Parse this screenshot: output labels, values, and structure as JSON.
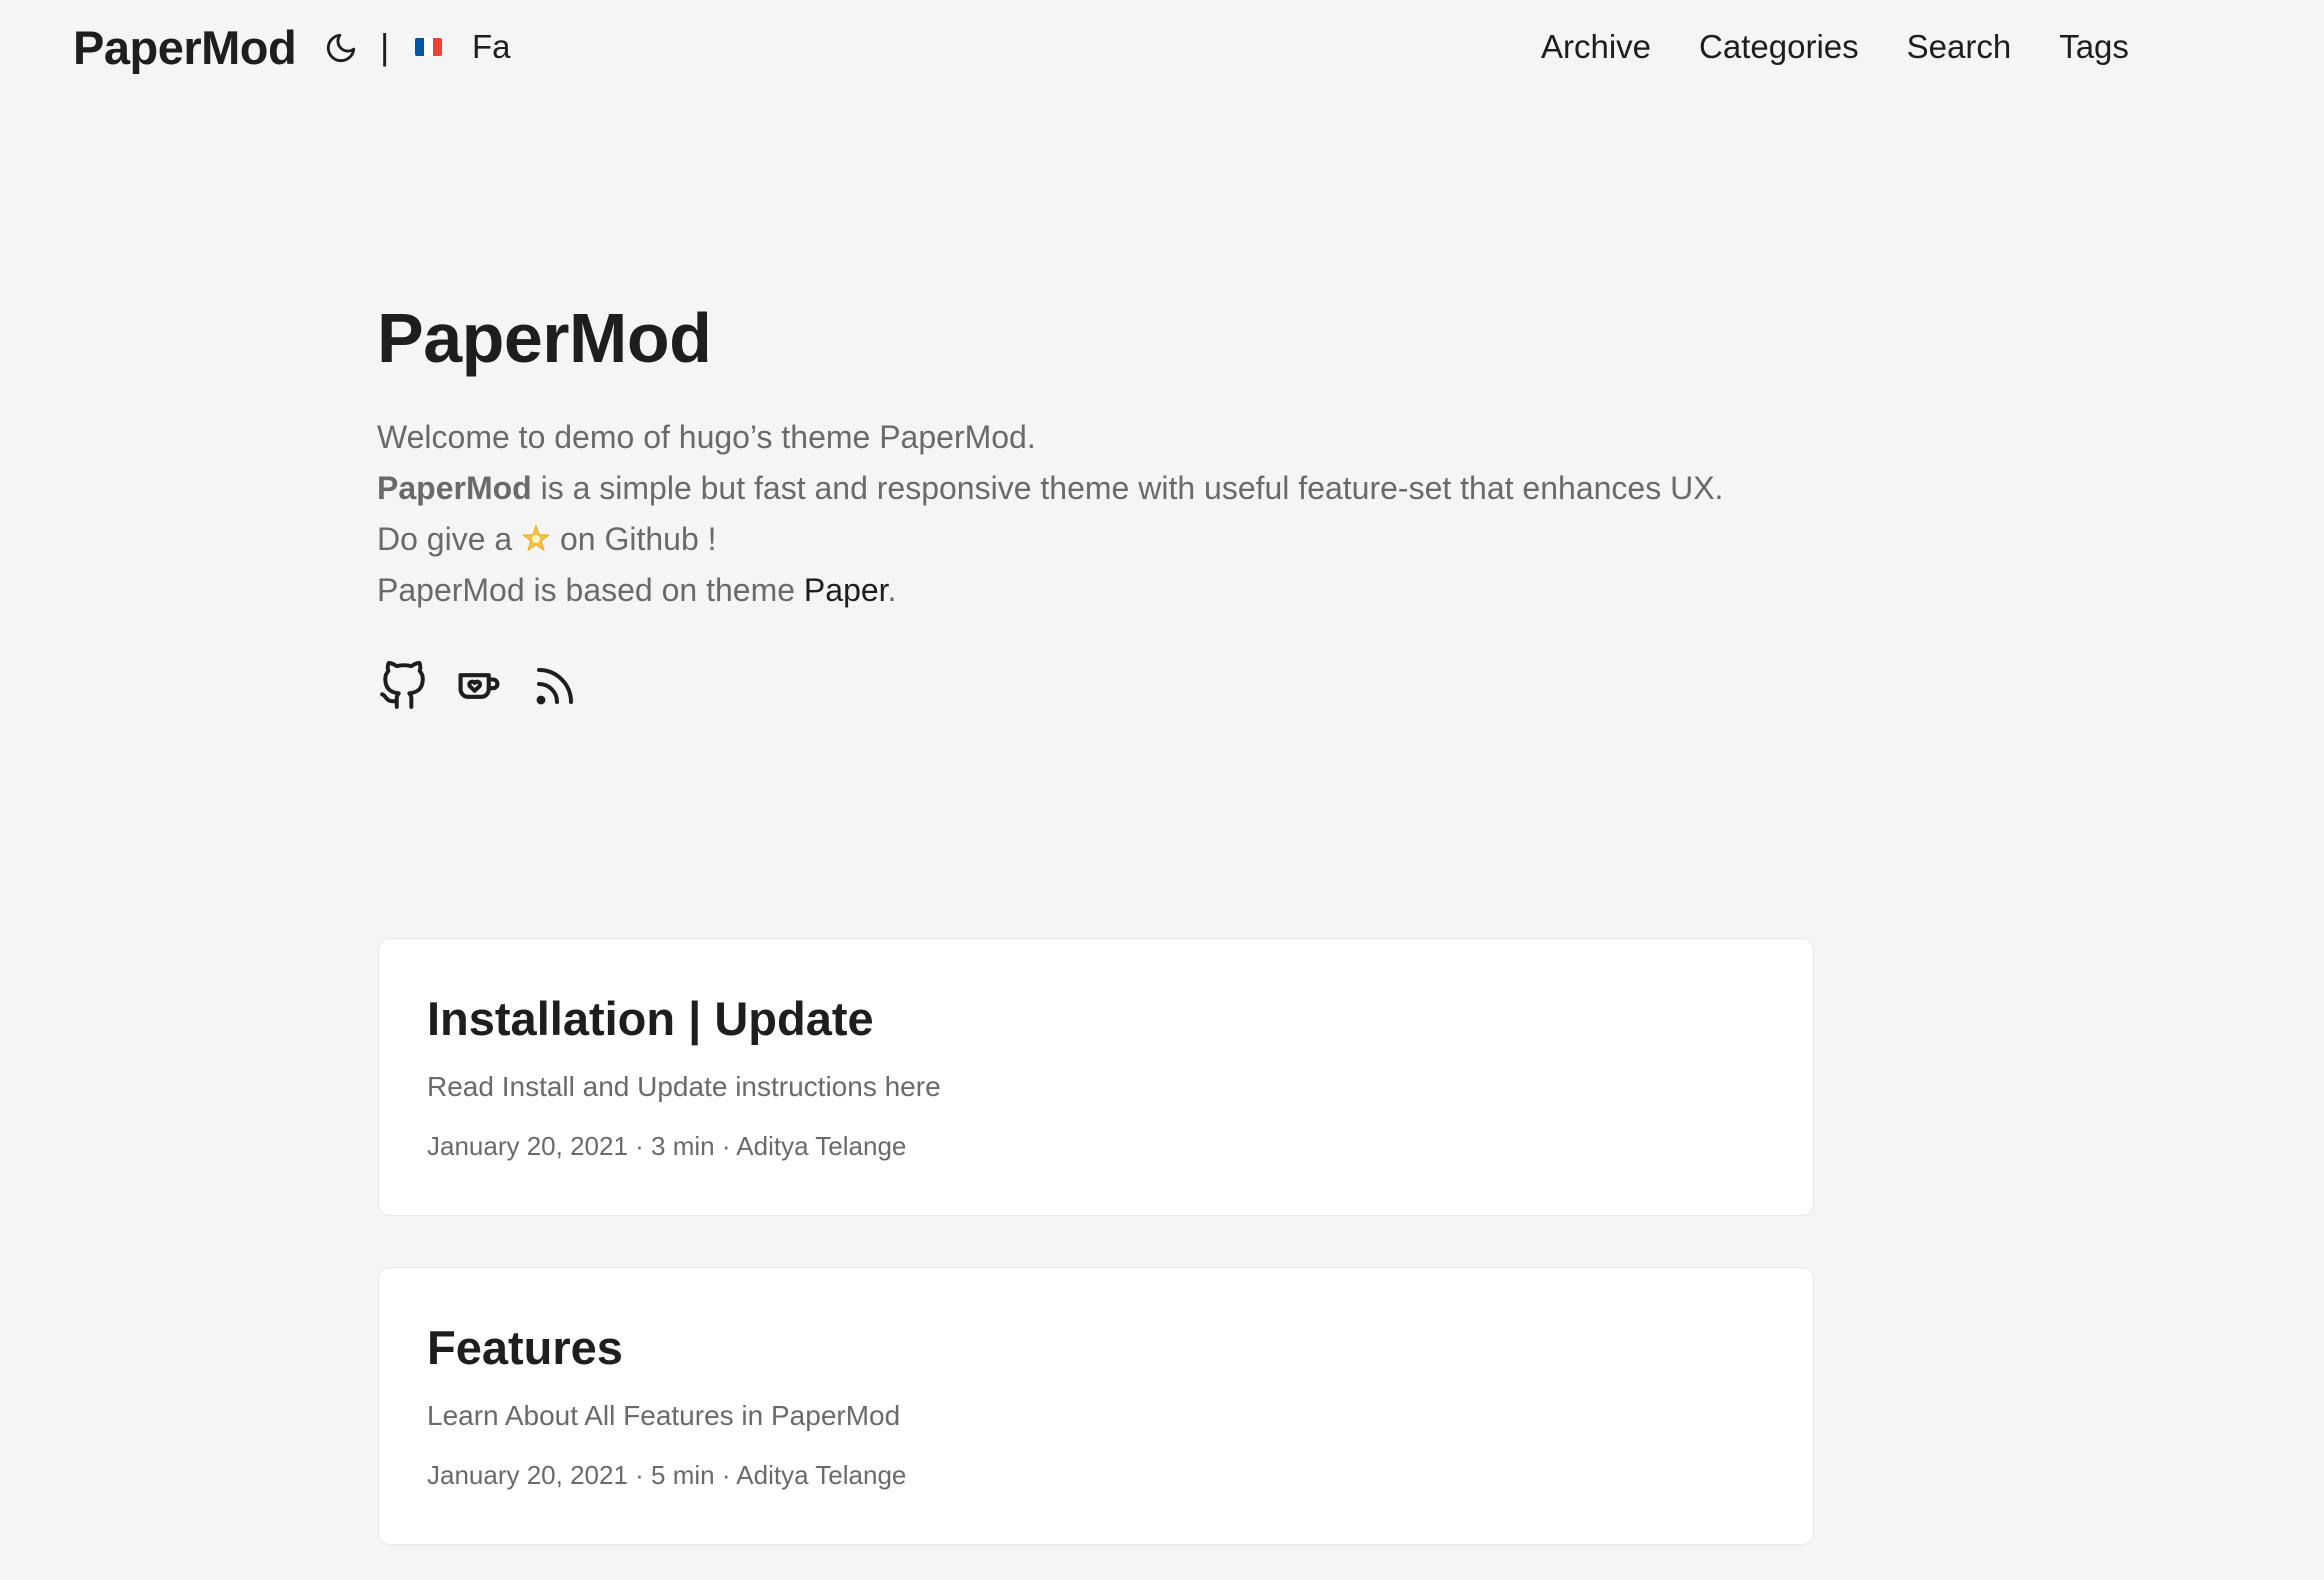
{
  "header": {
    "logo": "PaperMod",
    "theme_icon": "moon-icon",
    "lang_separator": "|",
    "flag_icon": "france-flag-icon",
    "flag_colors": [
      "#0055a4",
      "#ffffff",
      "#ef4135"
    ],
    "alt_lang": "Fa",
    "nav": [
      "Archive",
      "Categories",
      "Search",
      "Tags"
    ]
  },
  "profile": {
    "title": "PaperMod",
    "line1": "Welcome to demo of hugo’s theme PaperMod.",
    "line2_bold": "PaperMod",
    "line2_rest": " is a simple but fast and responsive theme with useful feature-set that enhances UX.",
    "line3_pre": "Do give a ",
    "line3_icon": "glowing-star-icon",
    "line3_post": " on Github !",
    "line4_pre": "PaperMod is based on theme ",
    "line4_link": "Paper",
    "line4_post": ".",
    "social_icons": [
      "github-icon",
      "kofi-cup-icon",
      "rss-icon"
    ]
  },
  "posts": [
    {
      "title": "Installation | Update",
      "summary": "Read Install and Update instructions here",
      "meta": "January 20, 2021 · 3 min · Aditya Telange"
    },
    {
      "title": "Features",
      "summary": "Learn About All Features in PaperMod",
      "meta": "January 20, 2021 · 5 min · Aditya Telange"
    }
  ],
  "colors": {
    "background": "#f5f5f5",
    "card": "#ffffff",
    "primary_text": "#1e1e1e",
    "secondary_text": "#6a6a6a"
  }
}
